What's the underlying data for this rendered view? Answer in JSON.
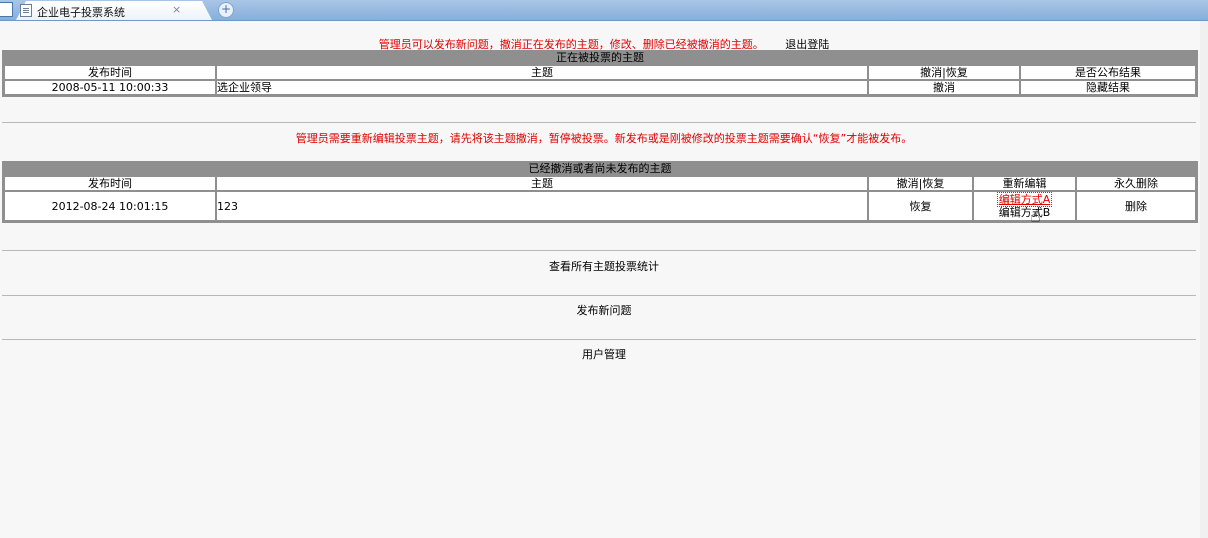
{
  "browser": {
    "tab_title": "企业电子投票系统",
    "tab_close": "×",
    "new_tab": "+"
  },
  "header": {
    "admin_notice": "管理员可以发布新问题，撤消正在发布的主题，修改、删除已经被撤消的主题。",
    "logout": "退出登陆"
  },
  "active_topics": {
    "title": "正在被投票的主题",
    "columns": [
      "发布时间",
      "主题",
      "撤消|恢复",
      "是否公布结果"
    ],
    "rows": [
      {
        "time": "2008-05-11 10:00:33",
        "topic": "选企业领导",
        "toggle": "撤消",
        "publish": "隐藏结果"
      }
    ]
  },
  "edit_notice": "管理员需要重新编辑投票主题，请先将该主题撤消，暂停被投票。新发布或是刚被修改的投票主题需要确认“恢复”才能被发布。",
  "cancelled_topics": {
    "title": "已经撤消或者尚未发布的主题",
    "columns": [
      "发布时间",
      "主题",
      "撤消|恢复",
      "重新编辑",
      "永久删除"
    ],
    "rows": [
      {
        "time": "2012-08-24 10:01:15",
        "topic": "123",
        "toggle": "恢复",
        "edit_a": "编辑方式A",
        "edit_b": "编辑方式B",
        "delete": "删除"
      }
    ]
  },
  "links": {
    "stats": "查看所有主题投票统计",
    "publish_new": "发布新问题",
    "user_mgmt": "用户管理"
  },
  "colors": {
    "notice": "#e00000",
    "panel_header": "#8f8f8f"
  }
}
